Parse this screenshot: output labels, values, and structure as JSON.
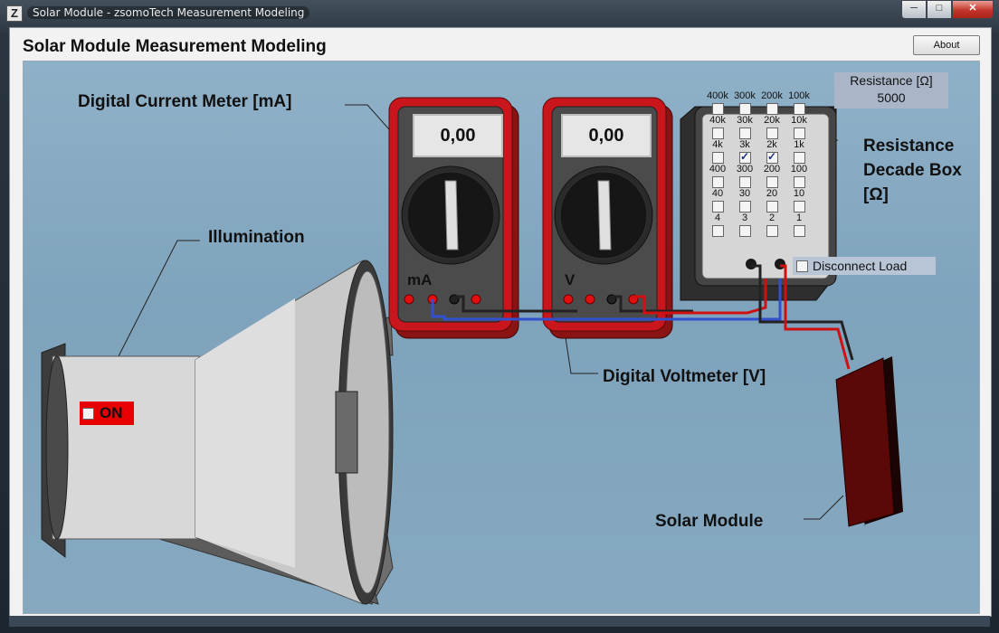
{
  "window": {
    "title": "Solar Module - zsomoTech Measurement Modeling"
  },
  "app": {
    "title": "Solar Module Measurement Modeling",
    "about_label": "About"
  },
  "callouts": {
    "current_meter": "Digital Current Meter [mA]",
    "illumination": "Illumination",
    "voltmeter": "Digital Voltmeter [V]",
    "resistance_box": "Resistance Decade Box [Ω]",
    "solar_module": "Solar Module"
  },
  "ammeter": {
    "reading": "0,00",
    "unit": "mA"
  },
  "voltmeter": {
    "reading": "0,00",
    "unit": "V"
  },
  "resistance": {
    "label": "Resistance [Ω]",
    "value": "5000"
  },
  "decade_box": {
    "rows": [
      {
        "labels": [
          "400k",
          "300k",
          "200k",
          "100k"
        ],
        "checked": [
          false,
          false,
          false,
          false
        ]
      },
      {
        "labels": [
          "40k",
          "30k",
          "20k",
          "10k"
        ],
        "checked": [
          false,
          false,
          false,
          false
        ]
      },
      {
        "labels": [
          "4k",
          "3k",
          "2k",
          "1k"
        ],
        "checked": [
          false,
          true,
          true,
          false
        ]
      },
      {
        "labels": [
          "400",
          "300",
          "200",
          "100"
        ],
        "checked": [
          false,
          false,
          false,
          false
        ]
      },
      {
        "labels": [
          "40",
          "30",
          "20",
          "10"
        ],
        "checked": [
          false,
          false,
          false,
          false
        ]
      },
      {
        "labels": [
          "4",
          "3",
          "2",
          "1"
        ],
        "checked": [
          false,
          false,
          false,
          false
        ]
      }
    ]
  },
  "disconnect_load": {
    "label": "Disconnect Load",
    "checked": false
  },
  "illumination_switch": {
    "label": "ON",
    "checked": false
  },
  "colors": {
    "meter_red": "#c8161c",
    "wire_blue": "#3050d0",
    "wire_red": "#d01010",
    "background": "#86a9c0"
  }
}
